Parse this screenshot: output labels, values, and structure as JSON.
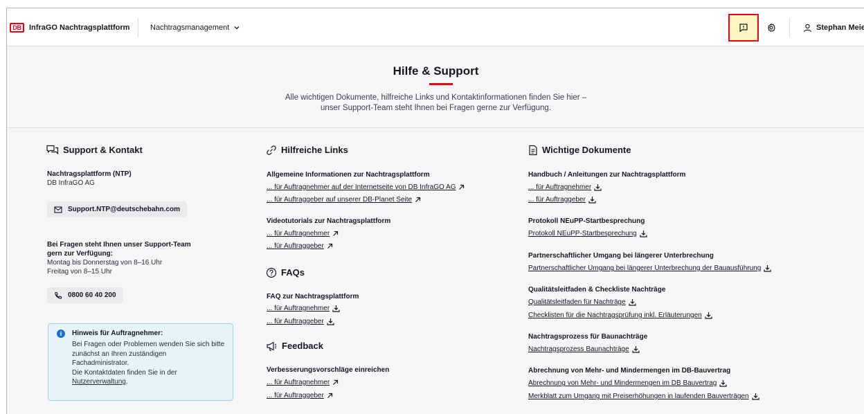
{
  "header": {
    "logo_text": "DB",
    "app_title": "InfraGO Nachtragsplattform",
    "nav_dropdown": "Nachtragsmanagement",
    "user_name": "Stephan Meier",
    "accent_color": "#ec0016",
    "highlight_color": "#fff6c4"
  },
  "hero": {
    "title": "Hilfe & Support",
    "subtitle_line1": "Alle wichtigen Dokumente, hilfreiche Links und Kontaktinformationen finden Sie hier –",
    "subtitle_line2": "unser Support-Team steht Ihnen bei Fragen gerne zur Verfügung."
  },
  "support": {
    "heading": "Support & Kontakt",
    "org_title": "Nachtragsplattform (NTP)",
    "org_name": "DB InfraGO AG",
    "email": "Support.NTP@deutschebahn.com",
    "hours_title_1": "Bei Fragen steht Ihnen unser Support-Team",
    "hours_title_2": "gern zur Verfügung:",
    "hours_line1": "Montag bis Donnerstag von 8–16 Uhr",
    "hours_line2": "Freitag von 8–15 Uhr",
    "phone": "0800 60 40 200",
    "note_title": "Hinweis für Auftragnehmer:",
    "note_line1": "Bei Fragen oder Problemen wenden Sie sich bitte",
    "note_line2": "zunächst an Ihren zuständigen",
    "note_line3": "Fachadministrator.",
    "note_line4": "Die Kontaktdaten finden Sie in der",
    "note_link": "Nutzerverwaltung",
    "note_link_suffix": "."
  },
  "links": {
    "heading": "Hilfreiche Links",
    "general_title": "Allgemeine Informationen zur Nachtragsplattform",
    "general_items": [
      "... für Auftragnehmer auf der Internetseite von DB InfraGO AG",
      "... für Auftraggeber auf unserer DB-Planet Seite"
    ],
    "video_title": "Videotutorials zur Nachtragsplattform",
    "video_items": [
      "... für Auftragnehmer",
      "... für Auftraggeber"
    ],
    "faq_heading": "FAQs",
    "faq_title": "FAQ zur Nachtragsplattform",
    "faq_items": [
      "... für Auftragnehmer",
      "... für Auftraggeber"
    ],
    "feedback_heading": "Feedback",
    "feedback_title": "Verbesserungsvorschläge einreichen",
    "feedback_items": [
      "... für Auftragnehmer",
      "... für Auftraggeber"
    ]
  },
  "docs": {
    "heading": "Wichtige Dokumente",
    "groups": [
      {
        "title": "Handbuch / Anleitungen zur Nachtragsplattform",
        "items": [
          "... für Auftragnehmer",
          "... für Auftraggeber"
        ]
      },
      {
        "title": "Protokoll NEuPP-Startbesprechung",
        "items": [
          "Protokoll NEuPP-Startbesprechung"
        ]
      },
      {
        "title": "Partnerschaftlicher Umgang bei längerer Unterbrechung",
        "items": [
          "Partnerschaftlicher Umgang bei längerer Unterbrechung der Bauausführung"
        ]
      },
      {
        "title": "Qualitätsleitfaden & Checkliste Nachträge",
        "items": [
          "Qualitätsleitfaden für Nachträge",
          "Checklisten für die Nachtragsprüfung inkl. Erläuterungen"
        ]
      },
      {
        "title": "Nachtragsprozess für Baunachträge",
        "items": [
          "Nachtragsprozess Baunachträge"
        ]
      },
      {
        "title": "Abrechnung von Mehr- und Mindermengen im DB-Bauvertrag",
        "items": [
          "Abrechnung von Mehr- und Mindermengen im DB Bauvertrag",
          "Merkblatt zum Umgang mit Preiserhöhungen in laufenden Bauverträgen"
        ]
      }
    ]
  }
}
